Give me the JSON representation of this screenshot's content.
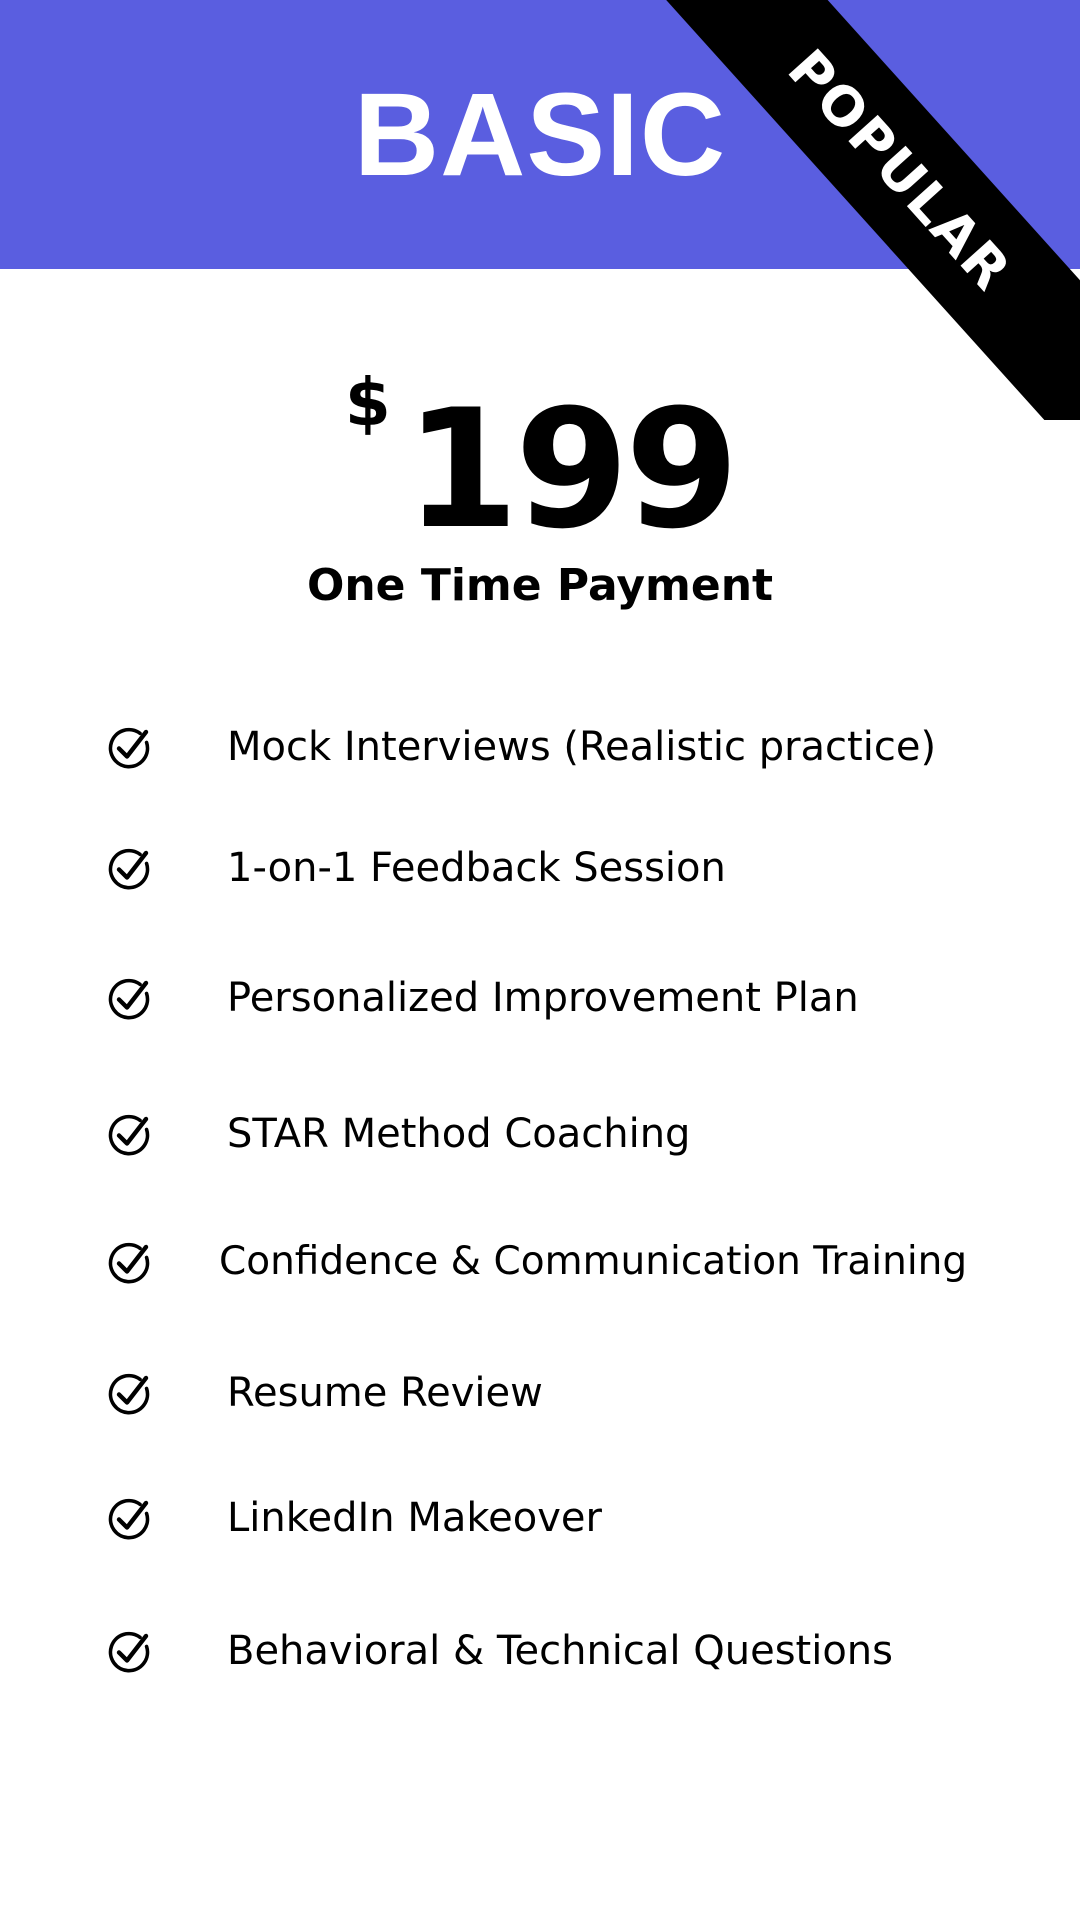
{
  "plan": {
    "name": "BASIC",
    "badge": "POPULAR",
    "currency_symbol": "$",
    "price": "199",
    "payment_type": "One Time Payment"
  },
  "features": [
    {
      "label": "Mock Interviews (Realistic practice)",
      "icon": "check-circle-icon"
    },
    {
      "label": "1-on-1 Feedback Session",
      "icon": "check-circle-icon"
    },
    {
      "label": "Personalized Improvement Plan",
      "icon": "check-circle-icon"
    },
    {
      "label": "STAR Method Coaching",
      "icon": "check-circle-icon"
    },
    {
      "label": "Confidence & Communication Training",
      "icon": "check-circle-icon"
    },
    {
      "label": "Resume Review",
      "icon": "check-circle-icon"
    },
    {
      "label": "LinkedIn Makeover",
      "icon": "check-circle-icon"
    },
    {
      "label": "Behavioral & Technical Questions",
      "icon": "check-circle-icon"
    }
  ],
  "colors": {
    "header_background": "#5a5ee0",
    "ribbon_background": "#000000",
    "text": "#000000",
    "header_text": "#ffffff"
  }
}
